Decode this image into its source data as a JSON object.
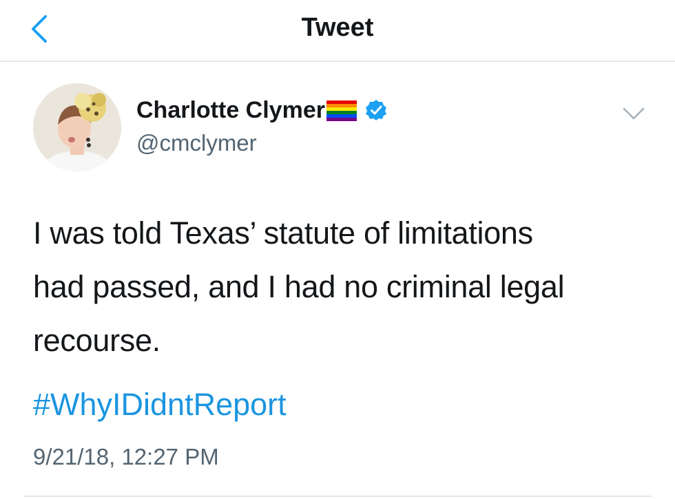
{
  "nav": {
    "title": "Tweet",
    "back_icon": "chevron-left-icon"
  },
  "tweet": {
    "author": {
      "display_name": "Charlotte Clymer",
      "handle": "@cmclymer",
      "flag_icon": "rainbow-flag-icon",
      "verified_icon": "verified-badge-icon"
    },
    "text_lines": [
      "I was told Texas’ statute of limitations",
      "had passed, and I had no criminal legal",
      "recourse."
    ],
    "hashtag": "#WhyIDidntReport",
    "timestamp": "9/21/18, 12:27 PM",
    "menu_icon": "chevron-down-icon"
  },
  "colors": {
    "link_blue": "#1b95e0",
    "verified_blue": "#1da1f2",
    "secondary_text": "#536471",
    "divider": "#e1e8ed"
  }
}
